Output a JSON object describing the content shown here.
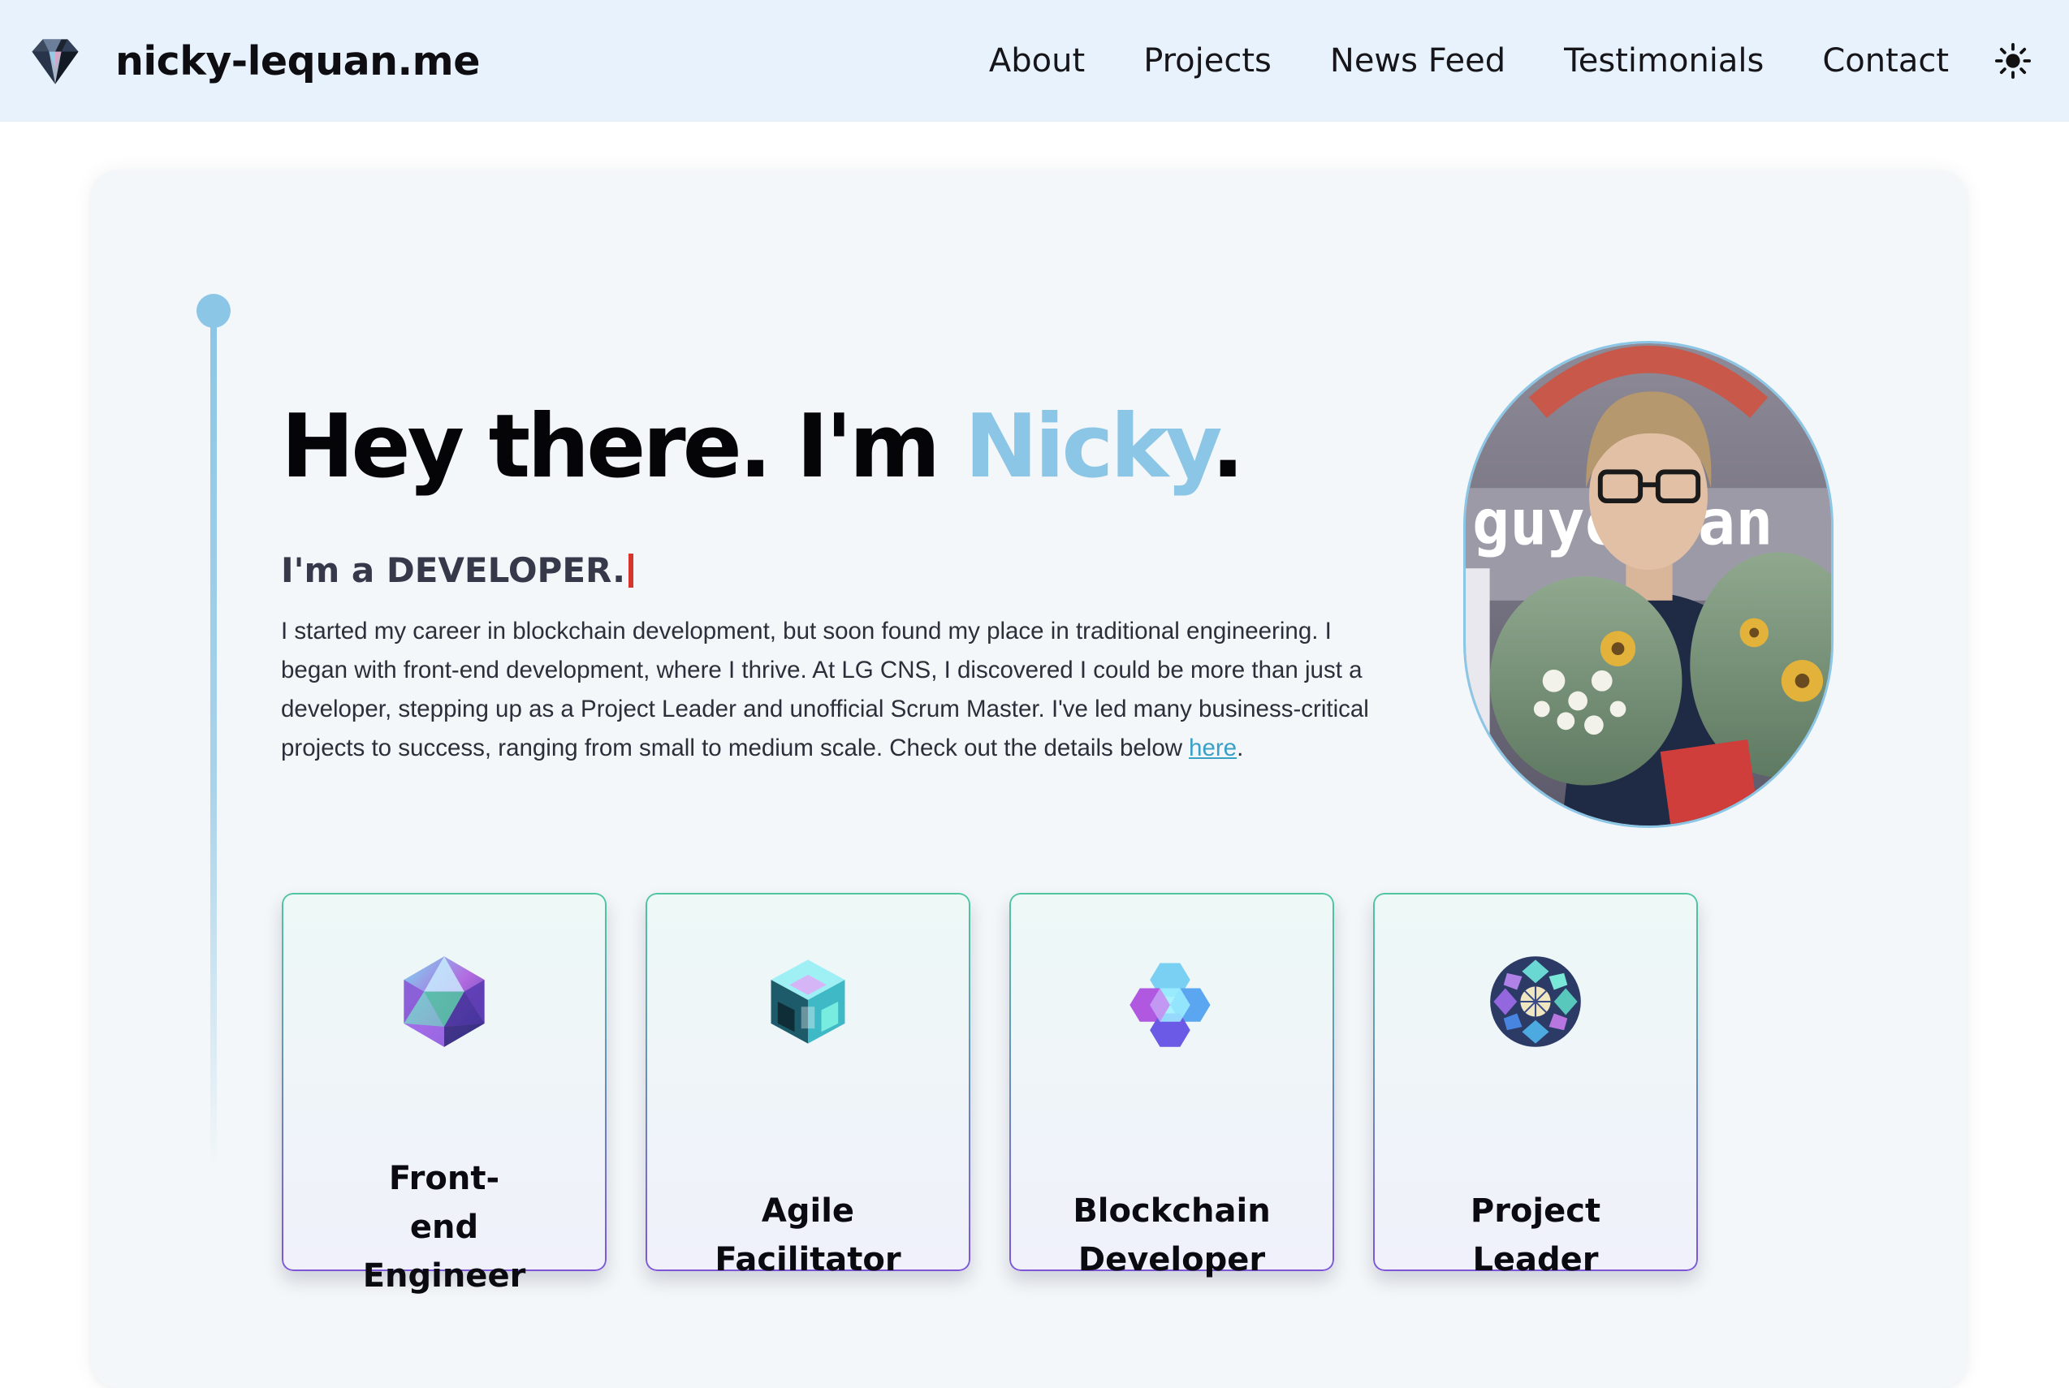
{
  "header": {
    "brand_name": "nicky-lequan.me",
    "logo_icon": "diamond-logo-icon",
    "nav": [
      {
        "label": "About"
      },
      {
        "label": "Projects"
      },
      {
        "label": "News Feed"
      },
      {
        "label": "Testimonials"
      },
      {
        "label": "Contact"
      }
    ],
    "theme_toggle_icon": "sun-icon",
    "background": "#e8f2fc"
  },
  "hero": {
    "title_prefix": "Hey there. I'm ",
    "title_name": "Nicky",
    "title_suffix": ".",
    "subtitle": "I'm a DEVELOPER.",
    "bio": "I started my career in blockchain development, but soon found my place in traditional engineering. I began with front-end development, where I thrive. At LG CNS, I discovered I could be more than just a developer, stepping up as a Project Leader and unofficial Scrum Master. I've led many business-critical projects to success, ranging from small to medium scale. Check out the details below",
    "bio_link": "here",
    "bio_end": ".",
    "accent_color": "#8cc6e6",
    "cursor_color": "#d6342c"
  },
  "portrait": {
    "banner_text": "guye  Van"
  },
  "roles": [
    {
      "label_line1": "Front-",
      "label_line2": "end",
      "label_line3": "Engineer",
      "icon": "crystal-icosahedron-icon"
    },
    {
      "label_line1": "Agile",
      "label_line2": "Facilitator",
      "icon": "holographic-cube-icon"
    },
    {
      "label_line1": "Blockchain",
      "label_line2": "Developer",
      "icon": "hexagon-cluster-icon"
    },
    {
      "label_line1": "Project",
      "label_line2": "Leader",
      "icon": "faceted-sphere-icon"
    }
  ]
}
